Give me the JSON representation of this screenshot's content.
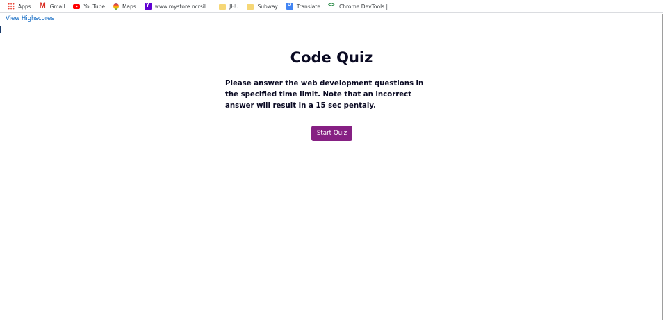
{
  "bookmarks": [
    {
      "label": "Apps",
      "icon": "apps-grid-icon"
    },
    {
      "label": "Gmail",
      "icon": "gmail-icon"
    },
    {
      "label": "YouTube",
      "icon": "youtube-icon"
    },
    {
      "label": "Maps",
      "icon": "maps-pin-icon"
    },
    {
      "label": "www.mystore.ncrsil...",
      "icon": "yahoo-icon"
    },
    {
      "label": "JHU",
      "icon": "folder-icon"
    },
    {
      "label": "Subway",
      "icon": "folder-icon"
    },
    {
      "label": "Translate",
      "icon": "translate-icon"
    },
    {
      "label": "Chrome DevTools  |...",
      "icon": "devtools-icon"
    }
  ],
  "header": {
    "highscores_link": "View Highscores"
  },
  "quiz": {
    "title": "Code Quiz",
    "instructions": "Please answer the web development questions in the specified time limit. Note that an incorrect answer will result in a 15 sec pentaly.",
    "start_label": "Start Quiz"
  },
  "colors": {
    "accent": "#862083",
    "link": "#0b66c2",
    "text": "#0a0a23"
  }
}
